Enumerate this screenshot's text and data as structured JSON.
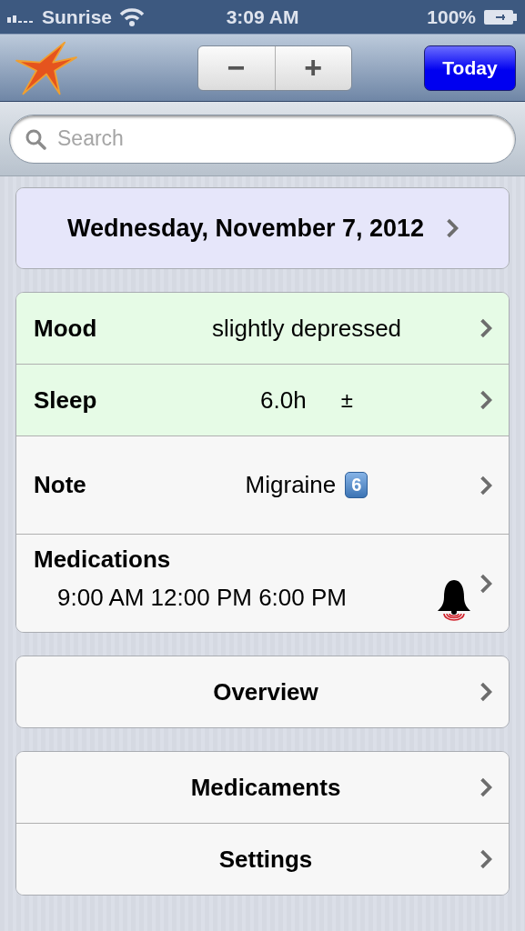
{
  "status_bar": {
    "carrier": "Sunrise",
    "time": "3:09 AM",
    "battery": "100%"
  },
  "nav_bar": {
    "minus": "−",
    "plus": "+",
    "today_button": "Today"
  },
  "search": {
    "placeholder": "Search"
  },
  "groups": [
    {
      "rows": [
        {
          "kind": "date",
          "title": "Wednesday, November 7, 2012",
          "color": "#e6e6fa"
        }
      ]
    },
    {
      "rows": [
        {
          "kind": "value",
          "label": "Mood",
          "value": "slightly depressed",
          "color": "#e6fbe6"
        },
        {
          "kind": "value",
          "label": "Sleep",
          "value": "6.0h",
          "extra": "±",
          "color": "#e6fbe6"
        },
        {
          "kind": "note",
          "label": "Note",
          "value": "Migraine",
          "badge": "6",
          "color": "#f7f7f7"
        },
        {
          "kind": "medications",
          "label": "Medications",
          "times": "9:00 AM 12:00 PM 6:00 PM",
          "alarm": true,
          "color": "#f7f7f7"
        }
      ]
    },
    {
      "rows": [
        {
          "kind": "link",
          "title": "Overview",
          "color": "#f7f7f7"
        }
      ]
    },
    {
      "rows": [
        {
          "kind": "link",
          "title": "Medicaments",
          "color": "#f7f7f7"
        },
        {
          "kind": "link",
          "title": "Settings",
          "color": "#f7f7f7"
        }
      ]
    }
  ]
}
